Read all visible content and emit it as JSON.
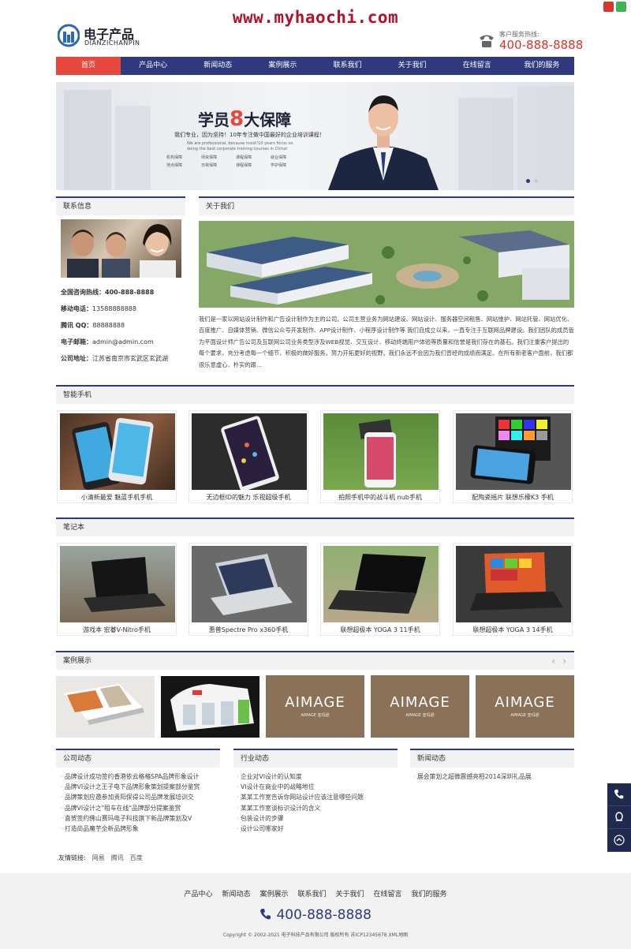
{
  "watermark": "www.myhaochi.com",
  "header": {
    "logo_title": "电子产品",
    "logo_sub": "DIANZICHANPIN",
    "hotline_label": "客户服务热线:",
    "hotline": "400-888-8888"
  },
  "nav": [
    "首页",
    "产品中心",
    "新闻动态",
    "案例展示",
    "联系我们",
    "关于我们",
    "在线留言",
    "我们的服务"
  ],
  "banner": {
    "title_pre": "学员",
    "title_num": "8",
    "title_post": "大保障",
    "line1": "我们专业，因为坚持！10年专注做中国最好的企业培训课程！",
    "line2": "We are professional, because insist!10 years focus on doing the best corporate training courses in China!",
    "tags": [
      "机构保障",
      "师资保障",
      "课程保障",
      "就业保障",
      "地点保障",
      "日常保障",
      "课程保障",
      "学护保障"
    ]
  },
  "contact": {
    "heading": "联系信息",
    "rows": [
      {
        "label": "全国咨询热线：",
        "value": "400-888-8888"
      },
      {
        "label": "移动电话：",
        "value": "13588888888"
      },
      {
        "label": "腾讯 QQ：",
        "value": "88888888"
      },
      {
        "label": "电子邮箱：",
        "value": "admin@admin.com"
      },
      {
        "label": "公司地址：",
        "value": "江苏省南京市玄武区玄武湖"
      }
    ]
  },
  "about": {
    "heading": "关于我们",
    "text": "我们是一家以网站设计制作和广告设计制作为主的公司。公司主营业务为网站建设、网站设计、服务器空间租售、网站维护、网站托管、网站优化、百度推广、自媒体营销、微信公众号开发制作、APP设计制作、小程序设计制作等 我们自成立以来，一直专注于互联网品牌建设。我们团队的成员皆为平面设计师广告公司及互联网公司业务类型涉及WEB视觉、交互设计、移动终端用户体验等质量和信誉是我们存在的基石。我们注重客户提出的每个要求，充分考虑每一个细节，积极的做好服务，努力开拓更好的视野。我们永远不会因为我们曾经的成绩而满足。在所有新老客户面前，我们都很乐意虚心、朴实的跟..."
  },
  "phones": {
    "heading": "智能手机",
    "items": [
      "小清新最爱 魅蓝手机手机",
      "无边框ID的魅力 乐视超级手机",
      "拍照手机中的战斗机 nub手机",
      "配陶瓷摇片 联想乐檬K3 手机"
    ]
  },
  "laptops": {
    "heading": "笔记本",
    "items": [
      "游戏本 宏碁V-Nitro手机",
      "惠普Spectre Pro x360手机",
      "联想超极本 YOGA 3 11手机",
      "联想超极本 YOGA 3 14手机"
    ]
  },
  "cases": {
    "heading": "案例展示",
    "prev": "‹",
    "next": "›",
    "brand": "AIMAGE",
    "brand_sub": "AIMAGE 亚玛逊"
  },
  "news": {
    "company": {
      "heading": "公司动态",
      "items": [
        "品牌设计成功签约香港依云格格SPA品牌形象设计",
        "品牌VI设计之王子电下品牌形象策划提案部分鉴赏",
        "品牌策划应邀参加贵阳保得公司品牌发展培训交",
        "品牌VI设计之\"租车在线\"品牌部分提案鉴赏",
        "喜贺签约佛山赛玛电子科技旗下新品牌策划及V",
        "打造尚品魔芋全新品牌形象"
      ]
    },
    "industry": {
      "heading": "行业动态",
      "items": [
        "企业对VI设计的认知度",
        "VI设计在商业中的战略地位",
        "某某工作室告诉你网站设计应该注意哪些问题",
        "某某工作室谈标识设计的含义",
        "包装设计的步骤",
        "设计公司哪家好"
      ]
    },
    "latest": {
      "heading": "新闻动态",
      "items": [
        "展会策划之超微震撼亮相2014深圳礼品展"
      ]
    }
  },
  "friend_links": {
    "label": "友情链接:",
    "items": [
      "网易",
      "腾讯",
      "百度"
    ]
  },
  "footer": {
    "nav": [
      "产品中心",
      "新闻动态",
      "案例展示",
      "联系我们",
      "关于我们",
      "在线留言",
      "我们的服务"
    ],
    "phone": "400-888-8888",
    "copyright": "Copyright © 2002-2021 电子科技产品有限公司 版权所有 苏ICP12345678 XML地图"
  },
  "colors": {
    "primary": "#2e3a7d",
    "accent": "#e8473e",
    "hotline": "#d9352a"
  }
}
